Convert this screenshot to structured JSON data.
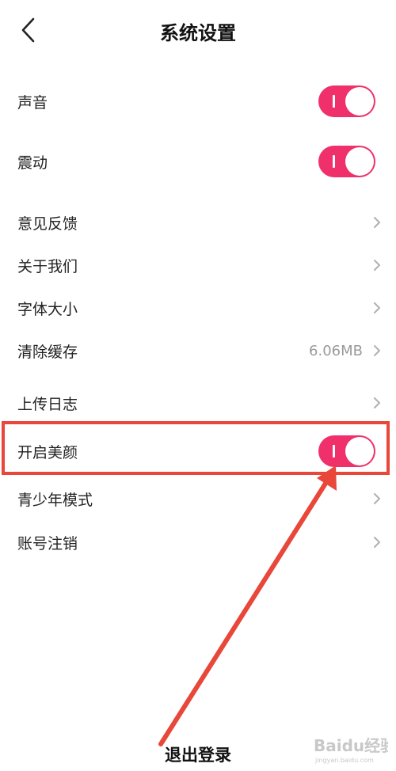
{
  "header": {
    "title": "系统设置",
    "back_icon": "chevron-left-icon"
  },
  "settings": [
    {
      "label": "声音",
      "type": "toggle",
      "on": true
    },
    {
      "label": "震动",
      "type": "toggle",
      "on": true
    },
    {
      "label": "意见反馈",
      "type": "nav"
    },
    {
      "label": "关于我们",
      "type": "nav"
    },
    {
      "label": "字体大小",
      "type": "nav"
    },
    {
      "label": "清除缓存",
      "type": "nav",
      "value": "6.06MB"
    },
    {
      "label": "上传日志",
      "type": "nav"
    },
    {
      "label": "开启美颜",
      "type": "toggle",
      "on": true
    },
    {
      "label": "青少年模式",
      "type": "nav"
    },
    {
      "label": "账号注销",
      "type": "nav"
    }
  ],
  "logout": {
    "label": "退出登录"
  },
  "watermark": {
    "text": "Baidu经验",
    "sub": "jingyan.baidu.com"
  },
  "colors": {
    "toggle_on": "#f0306a",
    "annotation": "#e8473a",
    "chevron": "#b0b0b0"
  }
}
